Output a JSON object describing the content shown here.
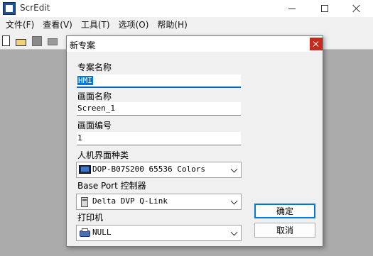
{
  "window": {
    "title": "ScrEdit"
  },
  "menu": {
    "items": [
      "文件(F)",
      "查看(V)",
      "工具(T)",
      "选项(O)",
      "帮助(H)"
    ]
  },
  "toolbar": {
    "icons": [
      "new-file-icon",
      "open-folder-icon",
      "save-icon",
      "print-icon"
    ]
  },
  "dialog": {
    "title": "新专案",
    "project_name_label": "专案名称",
    "project_name_value": "HMI",
    "screen_name_label": "画面名称",
    "screen_name_value": "Screen_1",
    "screen_number_label": "画面编号",
    "screen_number_value": "1",
    "hmi_type_label": "人机界面种类",
    "hmi_type_value": "DOP-B07S200 65536 Colors",
    "base_port_label": "Base Port 控制器",
    "base_port_value": "Delta DVP Q-Link",
    "printer_label": "打印机",
    "printer_value": "NULL",
    "ok_label": "确定",
    "cancel_label": "取消"
  },
  "colors": {
    "workspace": "#ababab",
    "selection": "#0078d7",
    "close_red": "#c42b1c"
  }
}
